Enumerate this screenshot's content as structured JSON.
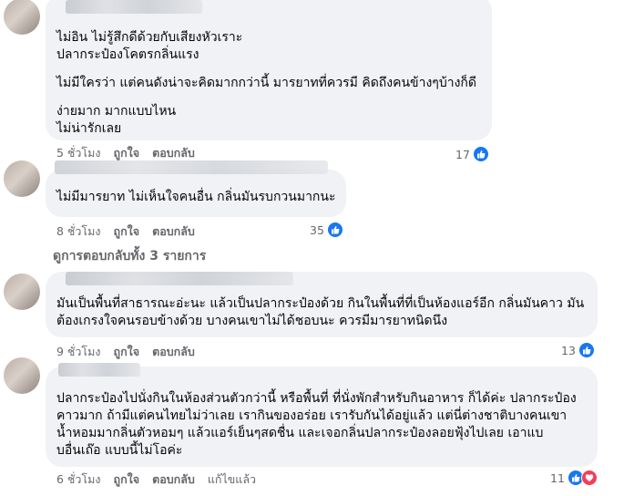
{
  "comments": [
    {
      "lines": [
        "ไม่อิน ไม่รู้สึกดีด้วยกับเสียงหัวเราะ",
        "ปลากระป๋องโคตรกลิ่นแรง",
        "",
        "ไม่มีใครว่า แต่คนดังน่าจะคิดมากกว่านี้ มารยาทที่ควรมี คิดถึงคนข้างๆบ้างก็ดี",
        "",
        "ง่ายมาก มากแบบไหน",
        "ไม่น่ารักเลย"
      ],
      "reaction_count": "17",
      "time": "5 ชั่วโมง",
      "like": "ถูกใจ",
      "reply": "ตอบกลับ"
    },
    {
      "lines": [
        "ไม่มีมารยาท ไม่เห็นใจคนอื่น กลิ่นมันรบกวนมากนะ"
      ],
      "reaction_count": "35",
      "time": "8 ชั่วโมง",
      "like": "ถูกใจ",
      "reply": "ตอบกลับ",
      "view_replies": "ดูการตอบกลับทั้ง 3 รายการ"
    },
    {
      "lines": [
        "มันเป็นพื้นที่สาธารณะอ่ะนะ แล้วเป็นปลากระป๋องด้วย กินในพื้นที่ที่เป็นห้องแอร์อีก กลิ่นมันคาว มัน",
        "ต้องเกรงใจคนรอบข้างด้วย บางคนเขาไม่ได้ชอบนะ ควรมีมารยาทนิดนึง"
      ],
      "reaction_count": "13",
      "time": "9 ชั่วโมง",
      "like": "ถูกใจ",
      "reply": "ตอบกลับ"
    },
    {
      "lines": [
        "ปลากระป๋องไปนั่งกินในห้องส่วนตัวกว่านี้ หรือพื้นที่ ที่นั่งพักสำหรับกินอาหาร ก็ได้ค่ะ ปลากระป๋อง",
        "คาวมาก ถ้ามีแต่คนไทยไม่ว่าเลย เรากินของอร่อย เรารับกันได้อยู่แล้ว แต่นี่ต่างชาติบางคนเขา",
        "น้ำหอมมากลิ่นตัวหอมๆ แล้วแอร์เย็นๆสดชื่น และเจอกลิ่นปลากระป๋องลอยฟุ้งไปเลย เอาแบ",
        "บอื่นเถ๊อ แบบนี้ไม่โอค่ะ"
      ],
      "reaction_count": "11",
      "time": "6 ชั่วโมง",
      "like": "ถูกใจ",
      "reply": "ตอบกลับ",
      "edited": "แก้ไขแล้ว"
    }
  ],
  "colors": {
    "bubble": "#f0f2f5",
    "meta_text": "#65676b",
    "like_blue": "#1877f2",
    "love_red": "#f33e58"
  },
  "icons": {
    "like": "like-thumb-icon",
    "love": "love-heart-icon"
  }
}
